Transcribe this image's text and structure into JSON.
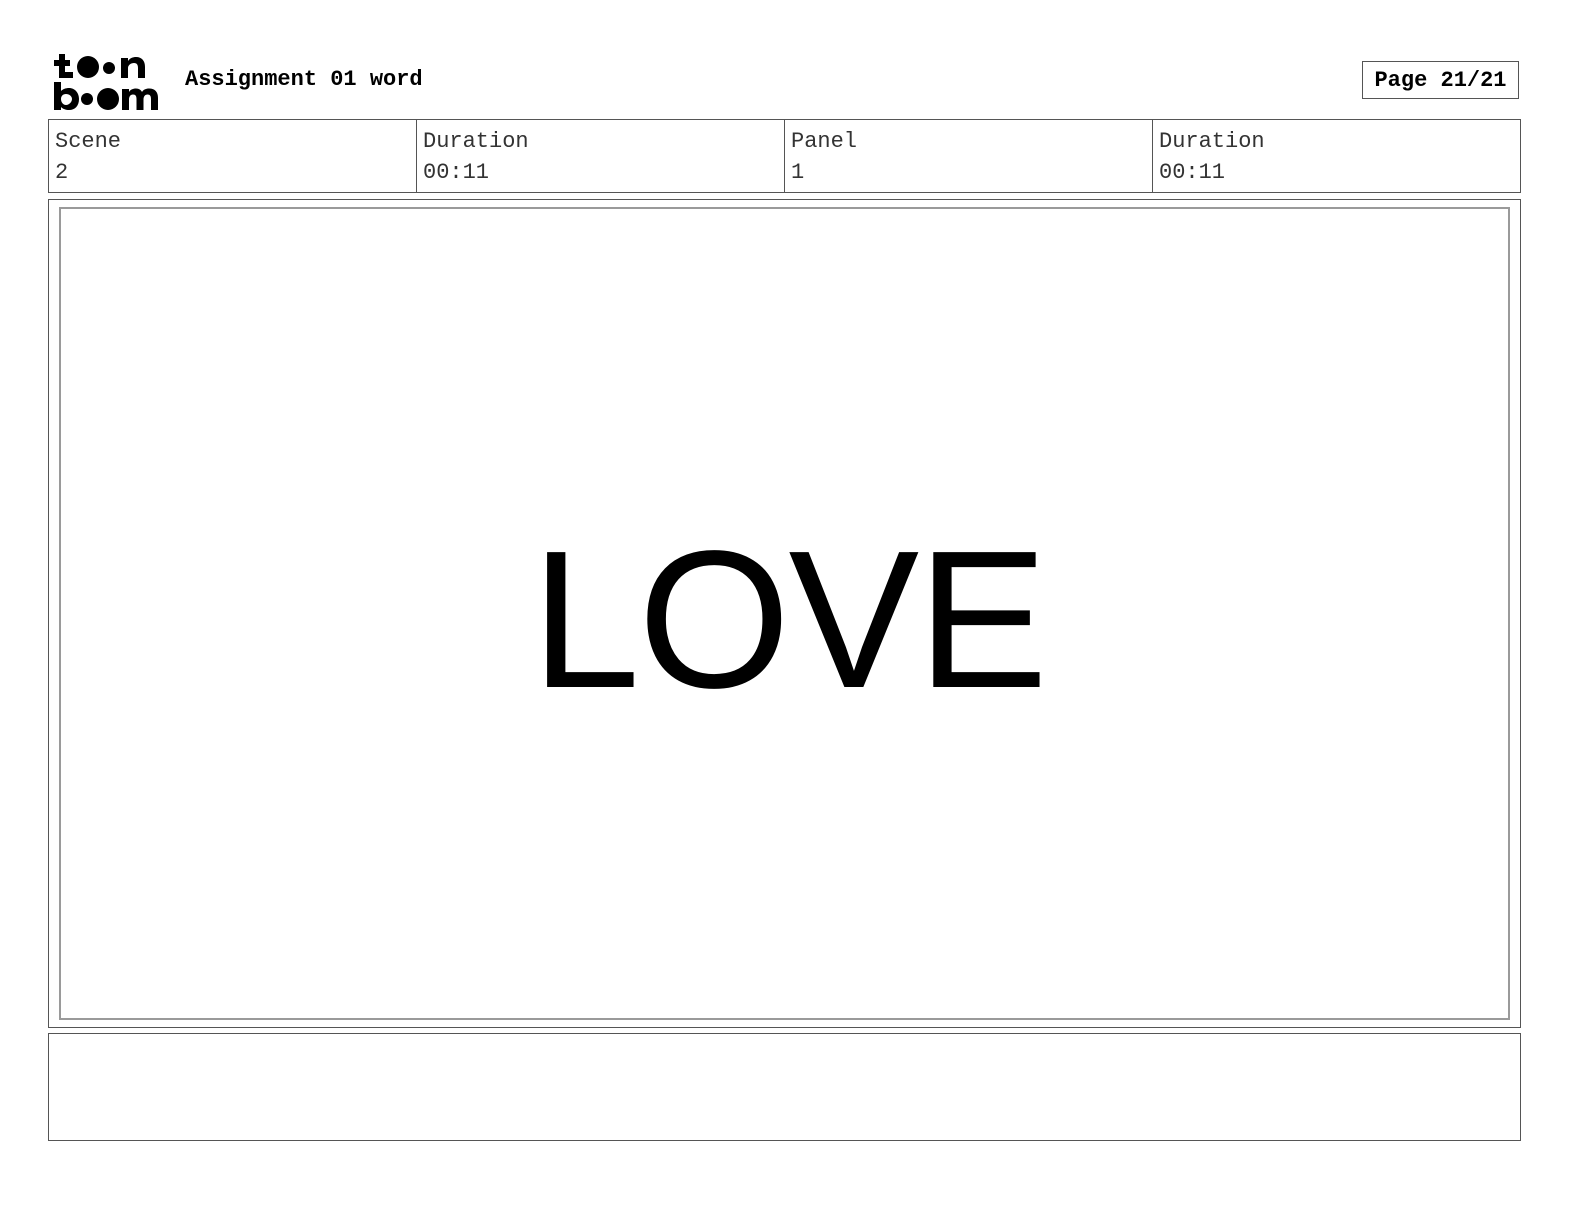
{
  "header": {
    "logo_alt": "toon boom",
    "project_title": "Assignment 01 word",
    "page_indicator": "Page 21/21"
  },
  "info": [
    {
      "label": "Scene",
      "value": "2"
    },
    {
      "label": "Duration",
      "value": "00:11"
    },
    {
      "label": "Panel",
      "value": "1"
    },
    {
      "label": "Duration",
      "value": "00:11"
    }
  ],
  "panel": {
    "image_text": "LOVE"
  },
  "notes": {
    "text": ""
  },
  "colors": {
    "border": "#555555",
    "inner_border": "#9a9a9a",
    "text": "#000000"
  }
}
